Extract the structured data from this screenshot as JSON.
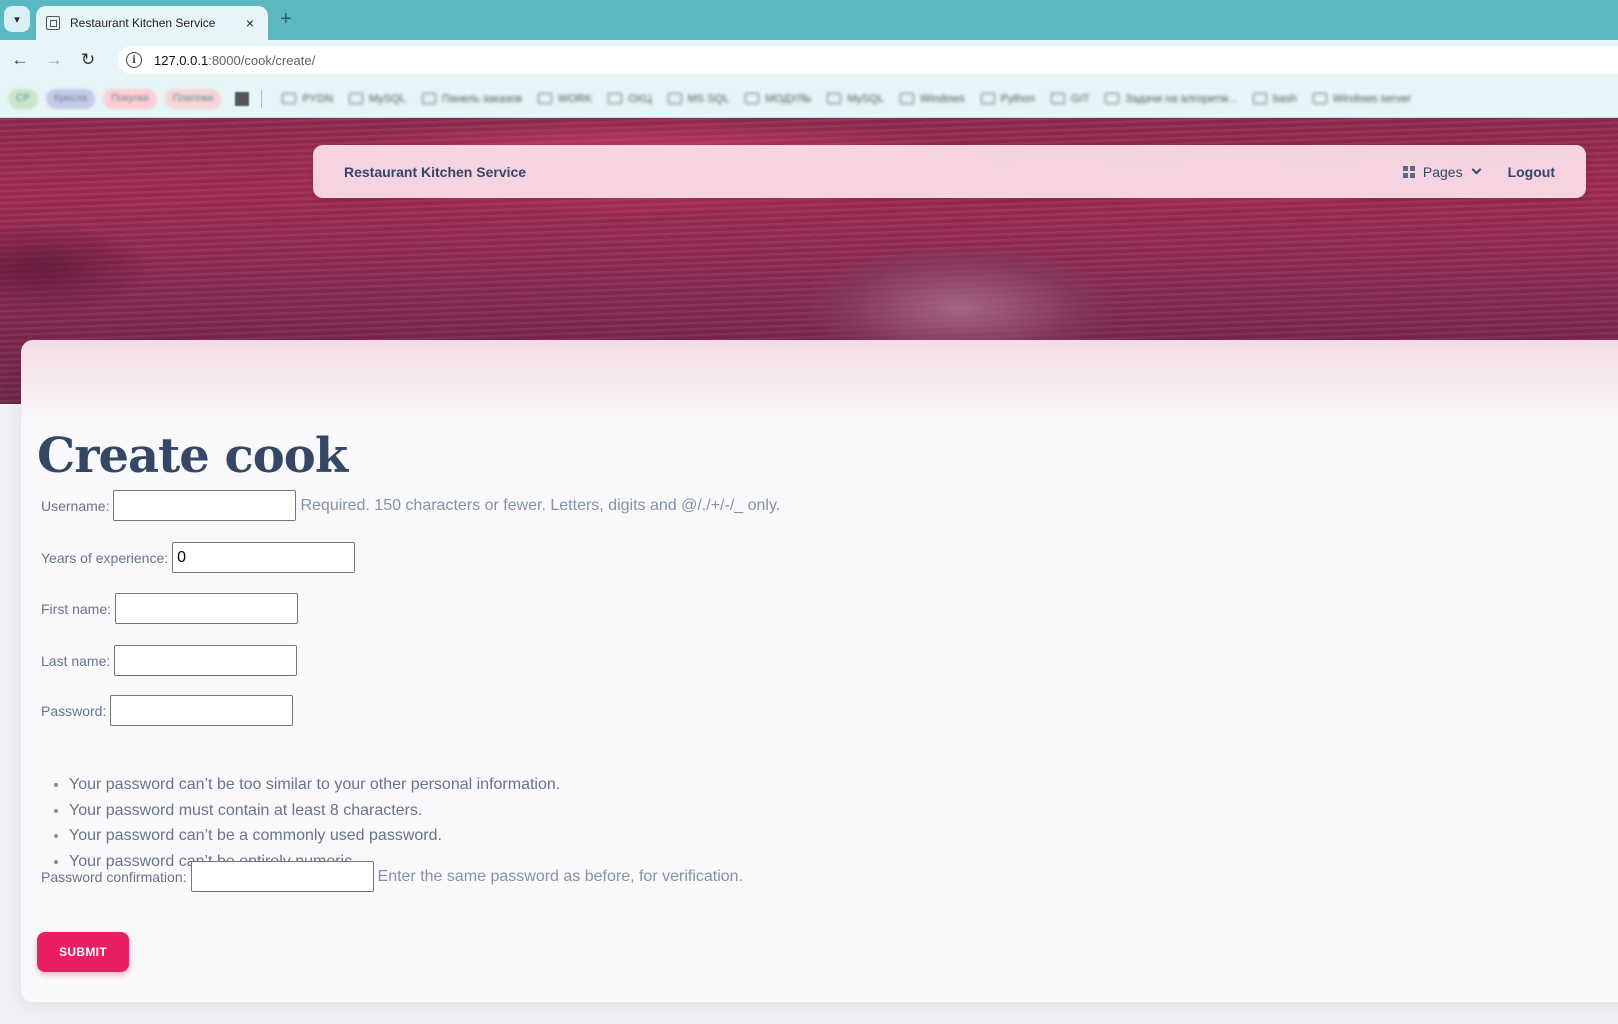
{
  "browser": {
    "tab_title": "Restaurant Kitchen Service",
    "tab_close": "×",
    "new_tab": "+",
    "url_host": "127.0.0.1",
    "url_path": ":8000/cook/create/",
    "bookmarks": [
      {
        "label": "СР",
        "bg": "#c8e6c9"
      },
      {
        "label": "Кресла",
        "bg": "#c5cae9"
      },
      {
        "label": "Покупки",
        "bg": "#ffcdd2"
      },
      {
        "label": "Платежи",
        "bg": "#f5d5d5"
      }
    ],
    "bookmark_folders": [
      "PYDN",
      "MySQL",
      "Панель заказов",
      "WORK",
      "ОХЦ",
      "MS SQL",
      "МОДУЛЬ",
      "MySQL",
      "Windows",
      "Python",
      "GIT",
      "Задачи на алгоритм...",
      "bash",
      "Windows server"
    ]
  },
  "navbar": {
    "brand": "Restaurant Kitchen Service",
    "pages_label": "Pages",
    "logout_label": "Logout"
  },
  "form": {
    "title": "Create cook",
    "username": {
      "label": "Username:",
      "value": "",
      "help": "Required. 150 characters or fewer. Letters, digits and @/./+/-/_ only."
    },
    "years": {
      "label": "Years of experience:",
      "value": "0"
    },
    "first_name": {
      "label": "First name:",
      "value": ""
    },
    "last_name": {
      "label": "Last name:",
      "value": ""
    },
    "password": {
      "label": "Password:",
      "value": ""
    },
    "password_rules": [
      "Your password can’t be too similar to your other personal information.",
      "Your password must contain at least 8 characters.",
      "Your password can’t be a commonly used password.",
      "Your password can’t be entirely numeric."
    ],
    "password_confirm": {
      "label": "Password confirmation:",
      "value": "",
      "help": "Enter the same password as before, for verification."
    },
    "submit_label": "SUBMIT"
  },
  "colors": {
    "accent": "#e91e63",
    "text_dark": "#344767",
    "tab_strip": "#5bb8c2"
  }
}
